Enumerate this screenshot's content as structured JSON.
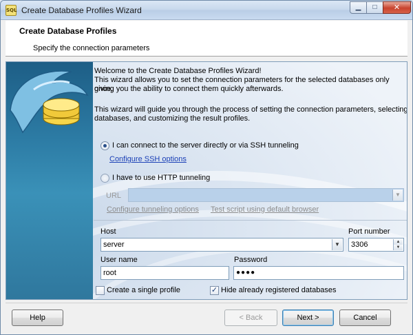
{
  "window": {
    "title": "Create Database Profiles Wizard",
    "app_icon_text": "SQL",
    "min_glyph": "▁",
    "max_glyph": "□",
    "close_glyph": "✕"
  },
  "header": {
    "title": "Create Database Profiles",
    "subtitle": "Specify the connection parameters"
  },
  "intro": {
    "line1": "Welcome to the Create Database Profiles Wizard!",
    "line2": "This wizard allows you to set the connection parameters for the selected databases only once,",
    "line3": "giving you the ability to connect them quickly afterwards.",
    "line4": "This wizard will guide you through the process of setting the connection parameters, selecting",
    "line5": "databases, and customizing the result profiles."
  },
  "connection": {
    "direct_label": "I can connect to the server directly or via SSH tunneling",
    "ssh_link": "Configure SSH options",
    "http_label": "I have to use HTTP tunneling",
    "url_label": "URL",
    "url_value": "",
    "tunneling_link": "Configure tunneling options",
    "test_link": "Test script using default browser"
  },
  "server": {
    "host_label": "Host",
    "host_value": "server",
    "port_label": "Port number",
    "port_value": "3306",
    "user_label": "User name",
    "user_value": "root",
    "password_label": "Password",
    "password_value": "●●●●"
  },
  "options": {
    "single_profile_label": "Create a single profile",
    "hide_registered_label": "Hide already registered databases",
    "check_glyph": "✓"
  },
  "buttons": {
    "help": "Help",
    "back": "< Back",
    "next": "Next >",
    "cancel": "Cancel"
  }
}
